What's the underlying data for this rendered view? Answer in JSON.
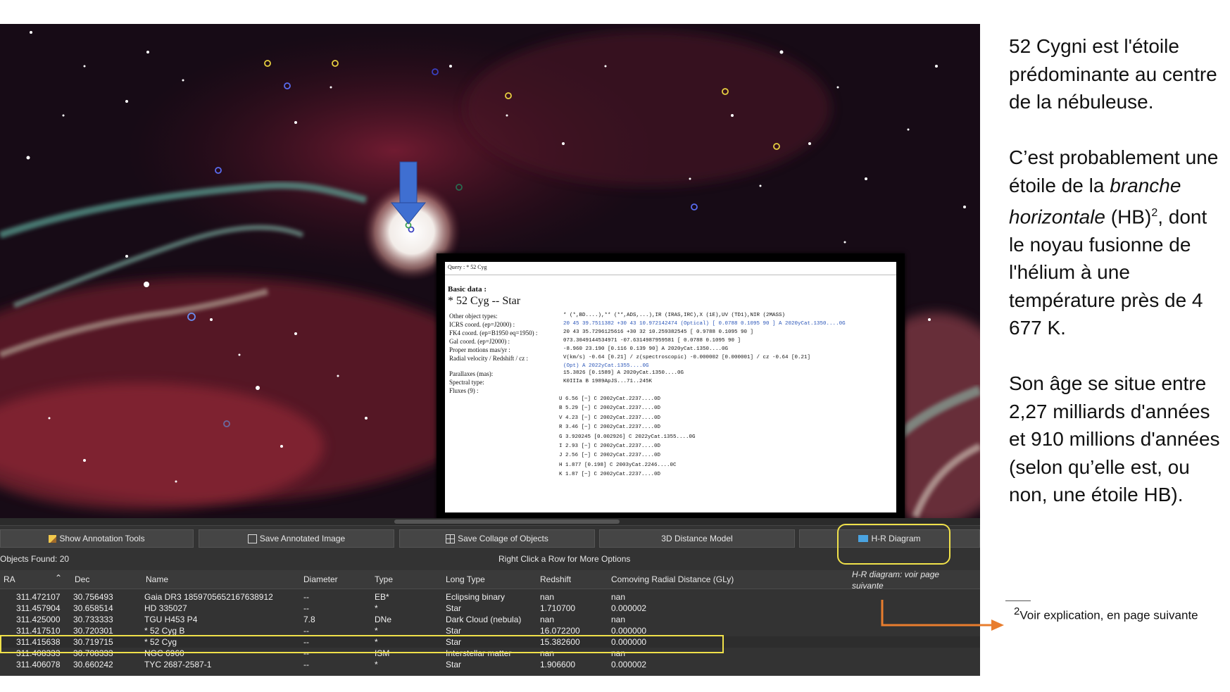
{
  "popup": {
    "query": "Query : * 52 Cyg",
    "basic": "Basic data :",
    "title": "* 52 Cyg -- Star",
    "rows": [
      {
        "k": "Other object types:",
        "v": "* (*,BD....),** (**,ADS,...),IR (IRAS,IRC),X (1E),UV (TD1),NIR (2MASS)"
      },
      {
        "k": "ICRS coord. (ep=J2000) :",
        "v": "20 45 39.7511382 +30 43 10.972142474 (Optical) [ 0.0788 0.1095 90 ] A 2020yCat.1350....0G"
      },
      {
        "k": "FK4 coord. (ep=B1950 eq=1950) :",
        "v": "20 43 35.7296125616 +30 32 10.259382545 [ 0.9788 0.1095 90 ]"
      },
      {
        "k": "Gal coord. (ep=J2000) :",
        "v": "073.3049144534971 -07.6314987959581 [ 0.0788 0.1095 90 ]"
      },
      {
        "k": "Proper motions mas/yr :",
        "v": "-8.960 23.190 [0.116 0.139 90] A 2020yCat.1350....0G"
      },
      {
        "k": "Radial velocity / Redshift / cz :",
        "v": "V(km/s) -0.64 [0.21] / z(spectroscopic) -0.000002 [0.000001] / cz -0.64 [0.21]"
      },
      {
        "k": "",
        "v": "(Opt) A 2022yCat.1355....0G"
      },
      {
        "k": "Parallaxes (mas):",
        "v": "15.3826 [0.1589] A 2020yCat.1350....0G"
      },
      {
        "k": "Spectral type:",
        "v": "K0IIIa B 1989ApJS...71..245K"
      },
      {
        "k": "Fluxes (9) :",
        "v": ""
      }
    ],
    "fluxes": [
      "U 6.56 [~] C 2002yCat.2237....0D",
      "B 5.29 [~] C 2002yCat.2237....0D",
      "V 4.23 [~] C 2002yCat.2237....0D",
      "R 3.46 [~] C 2002yCat.2237....0D",
      "G 3.920245 [0.002926] C 2022yCat.1355....0G",
      "I 2.93 [~] C 2002yCat.2237....0D",
      "J 2.56 [~] C 2002yCat.2237....0D",
      "H 1.877 [0.198] C 2003yCat.2246....0C",
      "K 1.87 [~] C 2002yCat.2237....0D"
    ]
  },
  "toolbar": {
    "annotation": "Show Annotation Tools",
    "save_image": "Save Annotated Image",
    "collage": "Save Collage of Objects",
    "distance": "3D Distance Model",
    "hr": "H-R Diagram"
  },
  "status": {
    "found": "Objects Found: 20",
    "hint": "Right Click a Row for More Options"
  },
  "table": {
    "headers": {
      "ra": "RA",
      "dec": "Dec",
      "name": "Name",
      "diameter": "Diameter",
      "type": "Type",
      "longtype": "Long Type",
      "redshift": "Redshift",
      "distance": "Comoving Radial Distance (GLy)"
    },
    "rows": [
      {
        "ra": "311.472107",
        "dec": "30.756493",
        "name": "Gaia DR3 1859705652167638912",
        "diameter": "--",
        "type": "EB*",
        "longtype": "Eclipsing binary",
        "redshift": "nan",
        "distance": "nan"
      },
      {
        "ra": "311.457904",
        "dec": "30.658514",
        "name": "HD 335027",
        "diameter": "--",
        "type": "*",
        "longtype": "Star",
        "redshift": "1.710700",
        "distance": "0.000002"
      },
      {
        "ra": "311.425000",
        "dec": "30.733333",
        "name": "TGU H453 P4",
        "diameter": "7.8",
        "type": "DNe",
        "longtype": "Dark Cloud (nebula)",
        "redshift": "nan",
        "distance": "nan"
      },
      {
        "ra": "311.417510",
        "dec": "30.720301",
        "name": "*  52 Cyg B",
        "diameter": "--",
        "type": "*",
        "longtype": "Star",
        "redshift": "16.072200",
        "distance": "0.000000"
      },
      {
        "ra": "311.415638",
        "dec": "30.719715",
        "name": "*  52 Cyg",
        "diameter": "--",
        "type": "*",
        "longtype": "Star",
        "redshift": "15.382600",
        "distance": "0.000000"
      },
      {
        "ra": "311.408333",
        "dec": "30.708333",
        "name": "NGC  6960",
        "diameter": "--",
        "type": "ISM",
        "longtype": "Interstellar matter",
        "redshift": "nan",
        "distance": "nan"
      },
      {
        "ra": "311.406078",
        "dec": "30.660242",
        "name": "TYC 2687-2587-1",
        "diameter": "--",
        "type": "*",
        "longtype": "Star",
        "redshift": "1.906600",
        "distance": "0.000002"
      }
    ]
  },
  "annotation": {
    "hr_note": "H-R diagram: voir page suivante"
  },
  "text": {
    "p1": "52 Cygni est l'étoile prédominante au centre de la nébuleuse.",
    "p2a": "C’est probablement une étoile de la ",
    "p2b": "branche horizontale",
    "p2c": " (HB)",
    "p2sup": "2",
    "p2d": ", dont le noyau fusionne de l'hélium à une température près de 4 677 K.",
    "p3": "Son âge se situe entre 2,27 milliards d'années et 910 millions d'années (selon qu’elle est, ou non, une étoile HB).",
    "fn_num": "2",
    "fn_text": "Voir explication, en page suivante"
  },
  "colors": {
    "highlight": "#f0e14a",
    "arrow_blue": "#3f6fd1",
    "arrow_orange": "#e87d2e",
    "panel": "#333333"
  }
}
